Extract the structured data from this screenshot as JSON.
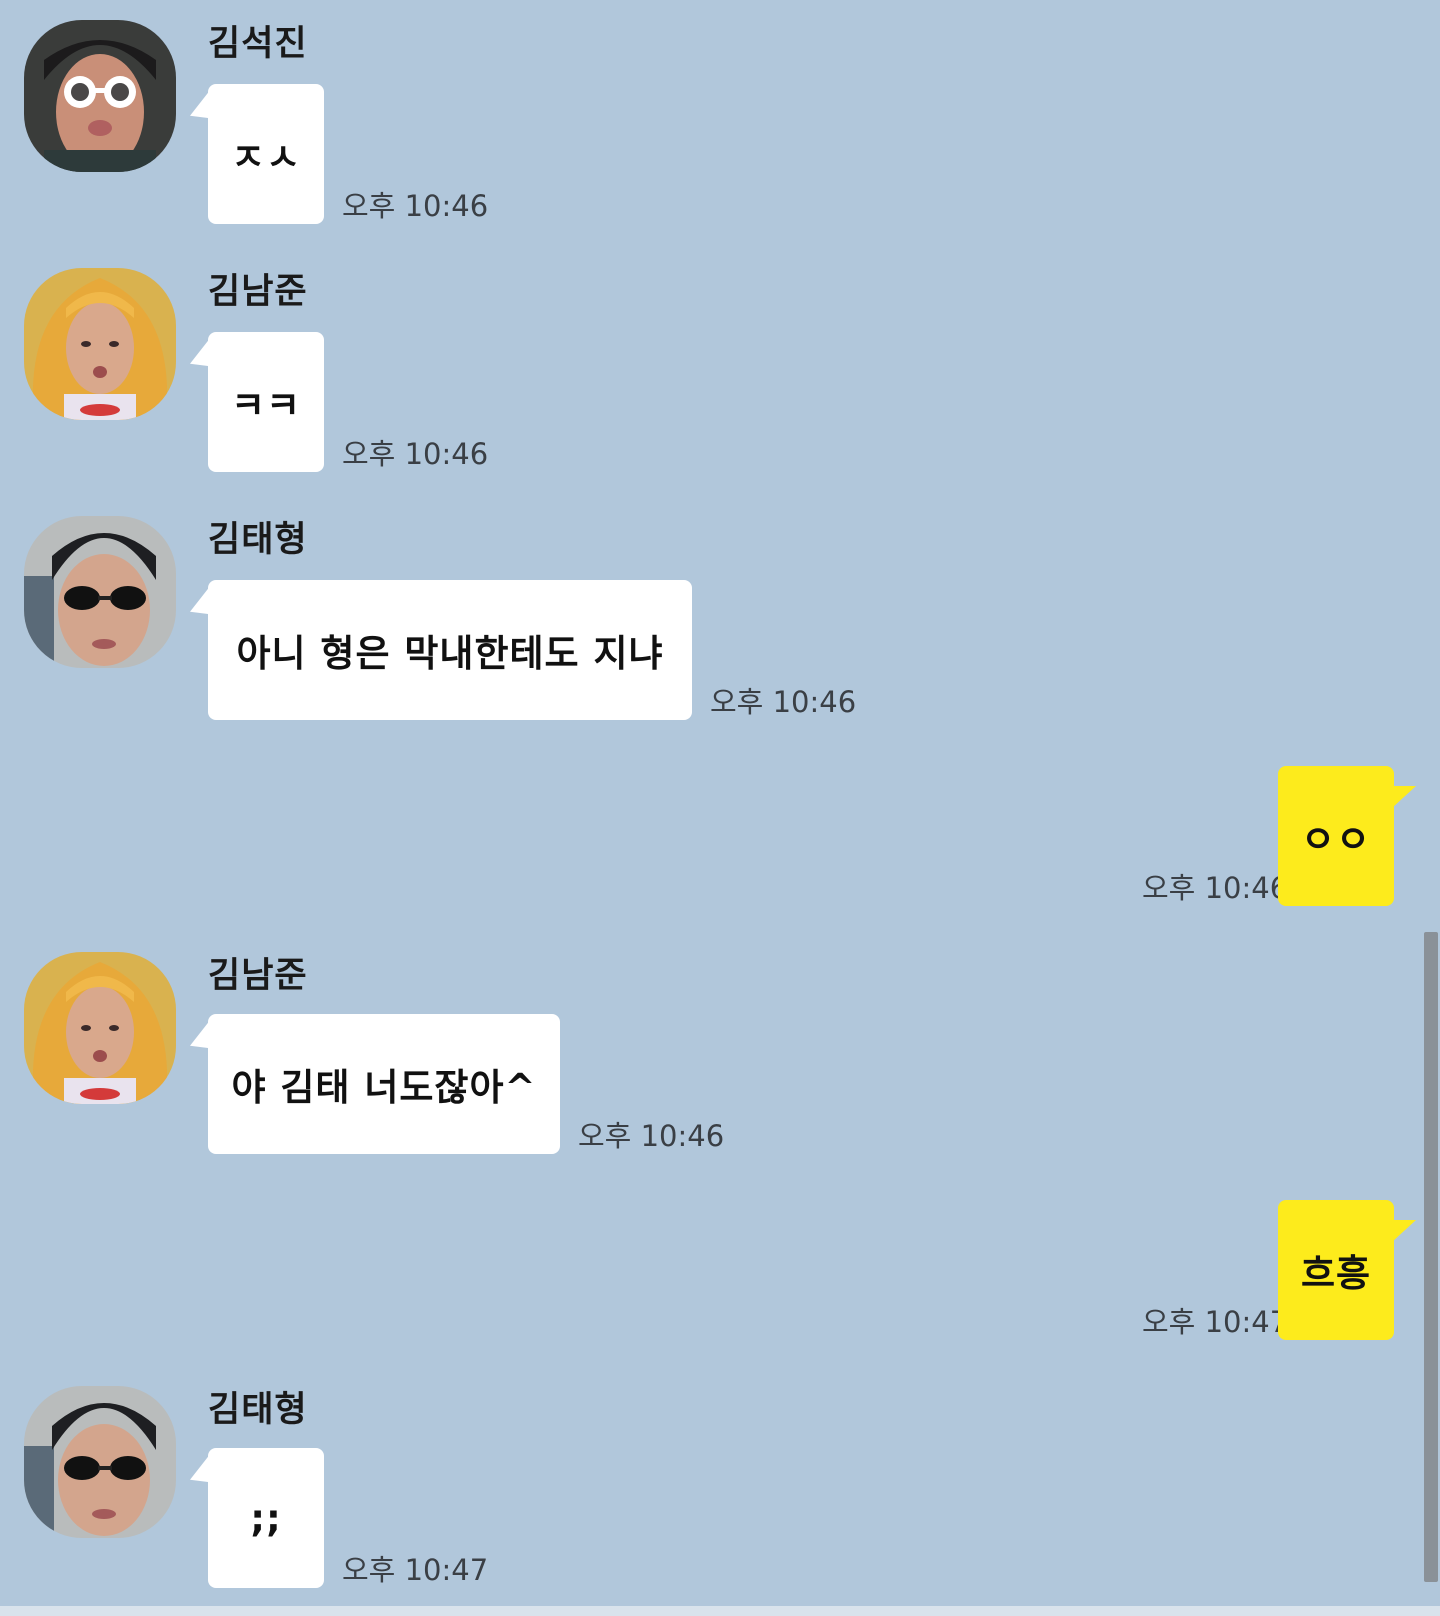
{
  "chat": {
    "messages": [
      {
        "sender": "김석진",
        "text": "ㅈㅅ",
        "time": "오후 10:46",
        "avatar_icon": "avatar-jin-white-glasses"
      },
      {
        "sender": "김남준",
        "text": "ㅋㅋ",
        "time": "오후 10:46",
        "avatar_icon": "avatar-namjoon-blonde-wig"
      },
      {
        "sender": "김태형",
        "text": "아니 형은 막내한테도 지냐",
        "time": "오후 10:46",
        "avatar_icon": "avatar-taehyung-sunglasses"
      },
      {
        "text": "ㅇㅇ",
        "time": "오후 10:46"
      },
      {
        "sender": "김남준",
        "text": "야 김태 너도잖아^",
        "time": "오후 10:46",
        "avatar_icon": "avatar-namjoon-blonde-wig"
      },
      {
        "text": "흐흥",
        "time": "오후 10:47"
      },
      {
        "sender": "김태형",
        "text": ";;",
        "time": "오후 10:47",
        "avatar_icon": "avatar-taehyung-sunglasses"
      }
    ]
  },
  "colors": {
    "background": "#b1c7db",
    "incoming_bubble": "#ffffff",
    "outgoing_bubble": "#fdeb1c",
    "scrollbar": "#8a9198"
  }
}
